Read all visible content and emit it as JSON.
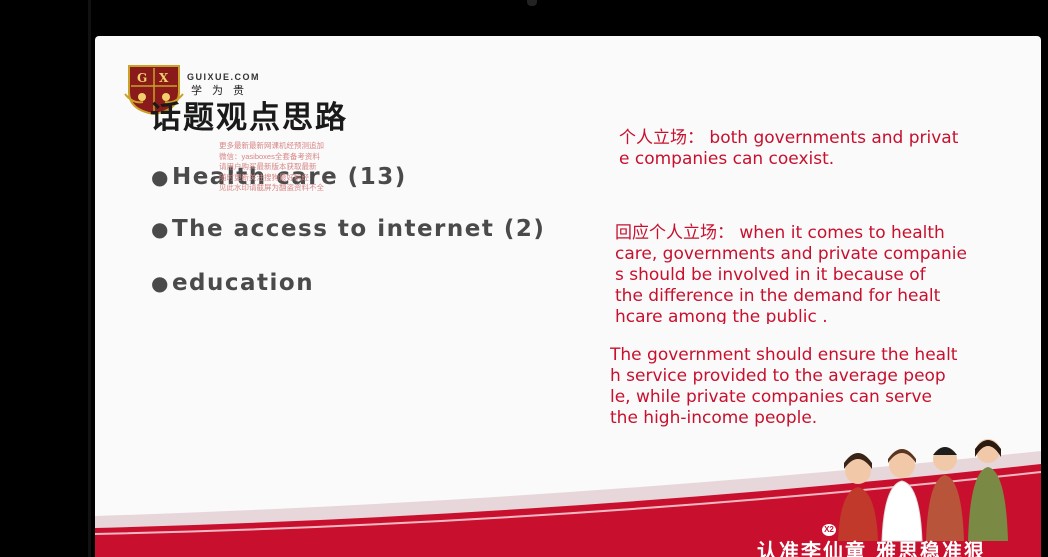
{
  "slide": {
    "brand_url": "GUIXUE.COM",
    "brand_cn": "学为贵",
    "title": "话题观点思路",
    "watermark_lines": [
      "更多最新最新网课机经预测追加",
      "微信：yasiboxes全套备考资料",
      "请用户购买最新版本获取最新",
      "随时更新关注搜狗最好机经",
      "见此水印请截屏为翻盗资料不全"
    ],
    "bullets": [
      "Health care (13)",
      "The access to internet (2)",
      "education"
    ],
    "bullet_symbol": "●",
    "note1_lines": [
      "个人立场：  both governments and privat",
      "e companies can coexist."
    ],
    "note2_lines": [
      "回应个人立场：  when it comes to health",
      "care, governments and private companie",
      "s should be involved in it because of",
      "the difference in the demand for healt",
      "hcare among the public ."
    ],
    "note3_lines": [
      "The government should ensure the healt",
      "h service provided to the average peop",
      "le, while private companies can serve",
      "the high-income people."
    ],
    "banner_text": "认准李仙童  雅思稳准狠",
    "badge": "X2"
  },
  "colors": {
    "note_red": "#c8102e",
    "banner_red": "#c8102e",
    "slide_bg": "#fafafa"
  }
}
